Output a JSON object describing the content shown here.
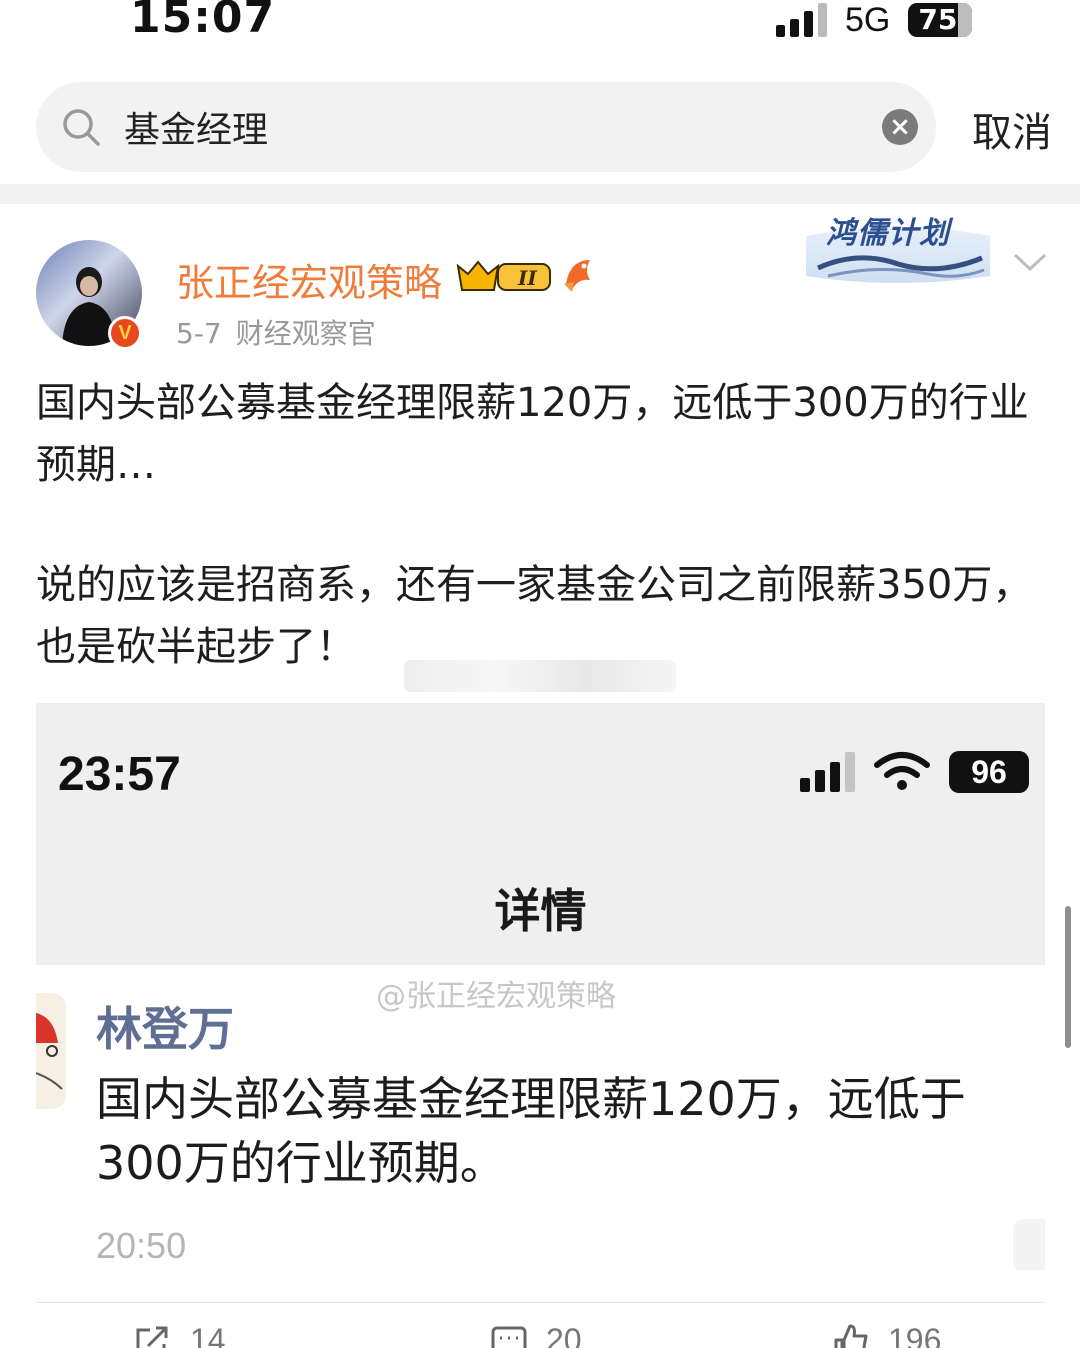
{
  "status_bar": {
    "time": "15:07",
    "network": "5G",
    "battery": "75"
  },
  "search": {
    "query": "基金经理",
    "cancel_label": "取消"
  },
  "post": {
    "author": "张正经宏观策略",
    "badge_text": "V",
    "member_badge_text": "II",
    "date": "5-7",
    "source": "财经观察官",
    "campaign_label": "鸿儒计划",
    "paragraphs": [
      "国内头部公募基金经理限薪120万，远低于300万的行业预期…",
      "说的应该是招商系，还有一家基金公司之前限薪350万，也是砍半起步了！"
    ]
  },
  "embedded": {
    "time": "23:57",
    "battery": "96",
    "title": "详情",
    "watermark": "@张正经宏观策略",
    "commenter": "林登万",
    "comment": "国内头部公募基金经理限薪120万，远低于300万的行业预期。",
    "comment_time": "20:50"
  },
  "actions": {
    "reposts": "14",
    "comments": "20",
    "likes": "196"
  },
  "colors": {
    "author": "#f07c3a",
    "commenter": "#5f6f93",
    "meta": "#999999"
  }
}
